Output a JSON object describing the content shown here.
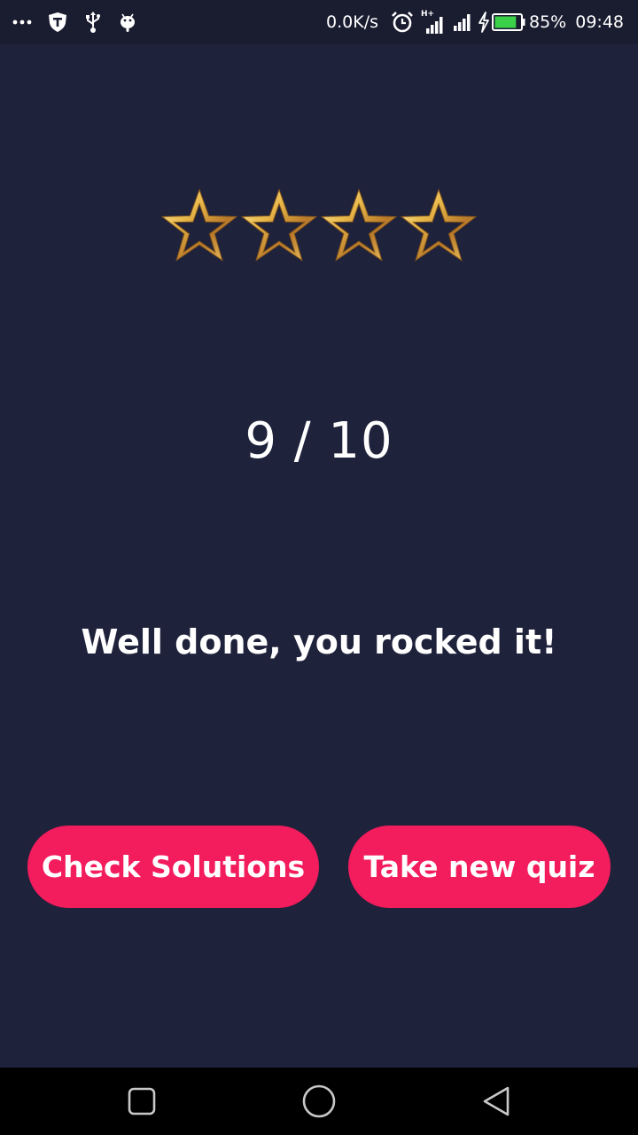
{
  "status_bar": {
    "network_speed": "0.0K/s",
    "network_type": "H+",
    "battery_percent": "85%",
    "battery_level": 0.85,
    "time": "09:48",
    "icons_left": [
      "more-dots-icon",
      "shield-icon",
      "usb-icon",
      "android-debug-icon"
    ],
    "icons_right": [
      "alarm-icon",
      "signal-icon",
      "signal-icon",
      "charging-icon",
      "battery-icon"
    ]
  },
  "result": {
    "stars_total": 4,
    "star_style": "outline-gold",
    "score": "9 / 10",
    "message": "Well done, you rocked it!"
  },
  "actions": {
    "check_solutions_label": "Check Solutions",
    "take_new_quiz_label": "Take new quiz"
  },
  "colors": {
    "background": "#1f223b",
    "status_bar": "#1a1c30",
    "accent": "#f31c5d",
    "star_gold": "#e8b84a",
    "nav_bar": "#000000"
  },
  "nav_bar": {
    "icons": [
      "recent-apps-icon",
      "home-icon",
      "back-icon"
    ]
  }
}
